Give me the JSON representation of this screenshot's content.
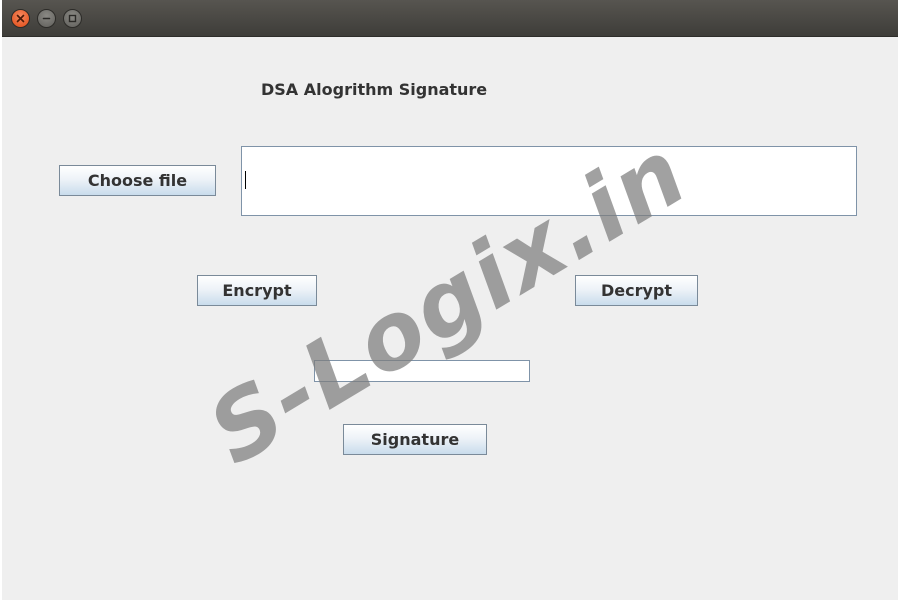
{
  "window": {
    "controls": {
      "close_icon": "close-icon",
      "minimize_icon": "minimize-icon",
      "maximize_icon": "maximize-icon"
    }
  },
  "main": {
    "heading": "DSA Alogrithm Signature",
    "choose_file_label": "Choose file",
    "file_text_value": "",
    "encrypt_label": "Encrypt",
    "decrypt_label": "Decrypt",
    "signature_value": "",
    "signature_label": "Signature"
  },
  "watermark": {
    "text": "S-Logix.in"
  },
  "colors": {
    "window_bg": "#efefef",
    "titlebar": "#4a4945",
    "close_button": "#e9571f",
    "button_border": "#7a8a99",
    "text": "#333333"
  }
}
